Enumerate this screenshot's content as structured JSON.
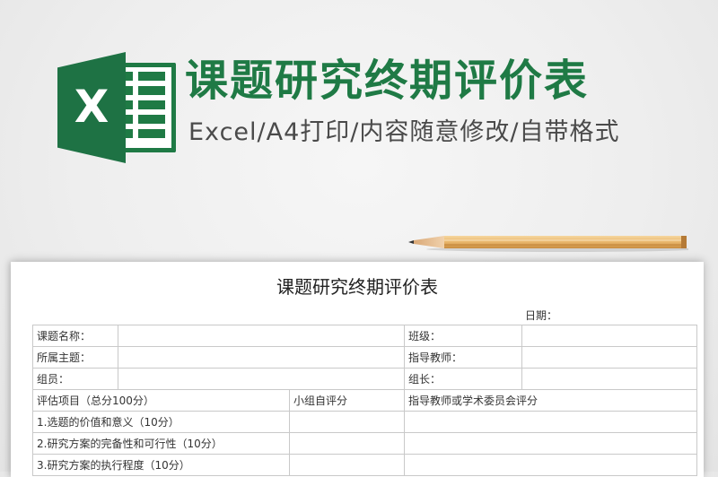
{
  "banner": {
    "title": "课题研究终期评价表",
    "subtitle": "Excel/A4打印/内容随意修改/自带格式",
    "logo_letter": "X",
    "brand_color": "#1f7a45"
  },
  "document": {
    "title": "课题研究终期评价表",
    "date_label": "日期：",
    "info_rows": [
      {
        "left_label": "课题名称：",
        "right_label": "班级："
      },
      {
        "left_label": "所属主题：",
        "right_label": "指导教师："
      },
      {
        "left_label": "组员：",
        "right_label": "组长："
      }
    ],
    "eval_header": {
      "item": "评估项目（总分100分）",
      "self": "小组自评分",
      "teacher": "指导教师或学术委员会评分"
    },
    "eval_rows": [
      "1.选题的价值和意义（10分）",
      "2.研究方案的完备性和可行性（10分）",
      "3.研究方案的执行程度（10分）"
    ]
  },
  "icons": [
    "excel-logo-icon",
    "pencil-icon"
  ]
}
